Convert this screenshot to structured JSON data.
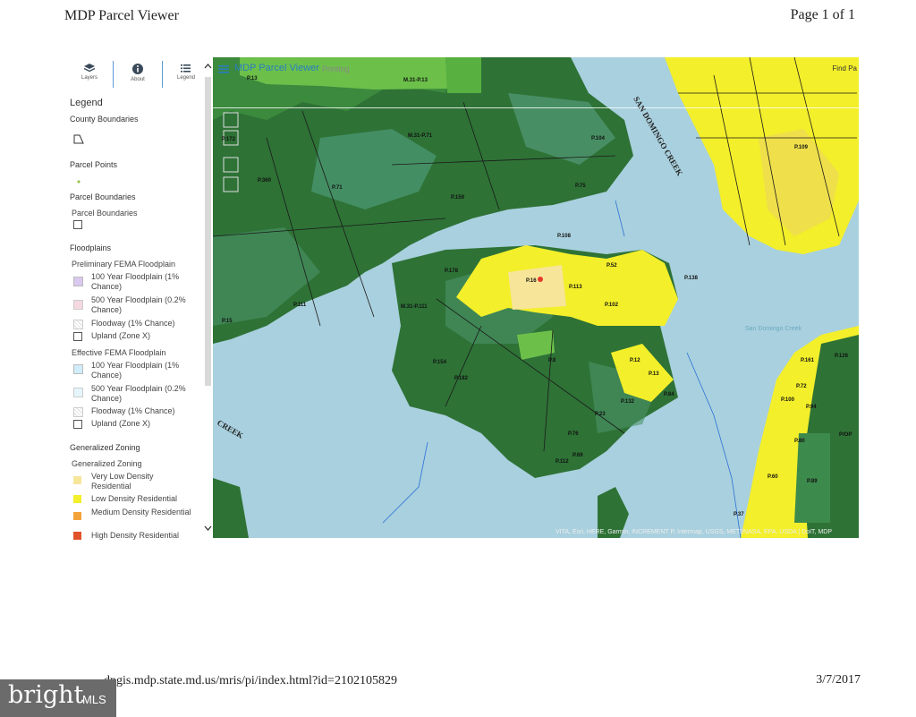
{
  "header": {
    "title": "MDP Parcel Viewer",
    "page": "Page 1 of 1"
  },
  "toolbar": {
    "layers": "Layers",
    "about": "About",
    "legend": "Legend"
  },
  "legend": {
    "title": "Legend",
    "county_boundaries": "County Boundaries",
    "parcel_points": "Parcel Points",
    "parcel_boundaries": "Parcel Boundaries",
    "parcel_boundaries_item": "Parcel Boundaries",
    "floodplains": "Floodplains",
    "prelim": "Preliminary FEMA Floodplain",
    "prelim_items": [
      "100 Year Floodplain (1% Chance)",
      "500 Year Floodplain (0.2% Chance)",
      "Floodway (1% Chance)",
      "Upland (Zone X)"
    ],
    "effective": "Effective FEMA Floodplain",
    "effective_items": [
      "100 Year Floodplain (1% Chance)",
      "500 Year Floodplain (0.2% Chance)",
      "Floodway (1% Chance)",
      "Upland (Zone X)"
    ],
    "zoning": "Generalized Zoning",
    "zoning_sub": "Generalized Zoning",
    "zoning_items": [
      "Very Low Density Residential",
      "Low Density Residential",
      "Medium Density Residential",
      "High Density Residential"
    ]
  },
  "colors": {
    "prelim": [
      "#d9c8f0",
      "#f6d8e0",
      "#f1eef0",
      "#ffffff"
    ],
    "effective": [
      "#cfeefa",
      "#e4f6fb",
      "#eef4f4",
      "#ffffff"
    ],
    "zoning": [
      "#f7e59a",
      "#f3ef2a",
      "#f3a33b",
      "#e2532a"
    ],
    "water": "#a9d0de",
    "forest": "#2f7a3a",
    "low_density": "#f3ef2a"
  },
  "map": {
    "title": "MDP Parcel Viewer",
    "printing": "Printing",
    "find": "Find Pa",
    "attribution": "VITA, Esri, HERE, Garmin, INCREMENT P, Intermap, USGS, METI/NASA, EPA, USDA | DoIT, MDP",
    "creek_1": "SAN DOMINGO CREEK",
    "creek_2": "CREEK",
    "creek_3": "San Domingo Creek",
    "labels": {
      "p13": "P.13",
      "m31p13": "M.31-P.13",
      "m31p71": "M.31-P.71",
      "p104": "P.104",
      "p172": "P.172",
      "p71": "P.71",
      "p159": "P.159",
      "p360": "P.360",
      "p75": "P.75",
      "p108": "P.108",
      "p178": "P.178",
      "p16": "P.16",
      "p111": "P.111",
      "m31p111": "M.31-P.111",
      "p113": "P.113",
      "p102": "P.102",
      "p138": "P.138",
      "p154": "P.154",
      "p182": "P.182",
      "p8": "P.8",
      "p12": "P.12",
      "p132": "P.132",
      "p109": "P.109",
      "p161": "P.161",
      "p72": "P.72",
      "p94": "P.94",
      "p80": "P.80",
      "p37": "P.37",
      "p76": "P.76",
      "p112": "P.112",
      "p69": "P.69",
      "p23": "P.23",
      "p84": "P.84",
      "p60": "P.60",
      "p89": "P.89",
      "p126": "P.126",
      "p100": "P.100",
      "p52": "P.52",
      "p15": "P.15",
      "pop": "P/OP"
    }
  },
  "footer": {
    "url": "dpgis.mdp.state.md.us/mris/pi/index.html?id=2102105829",
    "date": "3/7/2017"
  },
  "watermark": {
    "brand": "bright",
    "mls": "MLS"
  }
}
